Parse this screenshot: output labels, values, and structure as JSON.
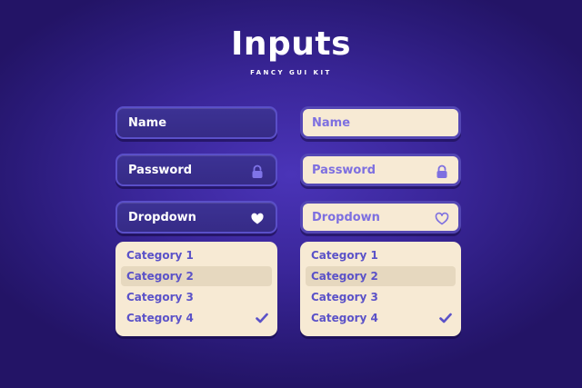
{
  "header": {
    "title": "Inputs",
    "subtitle": "FANCY GUI KIT"
  },
  "dark_column": {
    "name_label": "Name",
    "password_label": "Password",
    "dropdown_label": "Dropdown",
    "menu": [
      "Category 1",
      "Category 2",
      "Category 3",
      "Category 4"
    ],
    "selected_index": 1,
    "checked_index": 3
  },
  "light_column": {
    "name_label": "Name",
    "password_label": "Password",
    "dropdown_label": "Dropdown",
    "menu": [
      "Category 1",
      "Category 2",
      "Category 3",
      "Category 4"
    ],
    "selected_index": 1,
    "checked_index": 3
  },
  "icons": {
    "password": "lock-icon",
    "dark_dropdown": "heart-filled-icon",
    "light_dropdown": "heart-outline-icon",
    "menu_check": "check-icon"
  },
  "colors": {
    "background": "#2d1c80",
    "dark_field": "#3a2e8f",
    "dark_field_border": "#5a4fc8",
    "light_field": "#f7ead4",
    "light_field_border": "#5447b4",
    "light_text": "#7d6fe0",
    "menu_text": "#5b52c8",
    "menu_selected": "#e6d8bf"
  }
}
